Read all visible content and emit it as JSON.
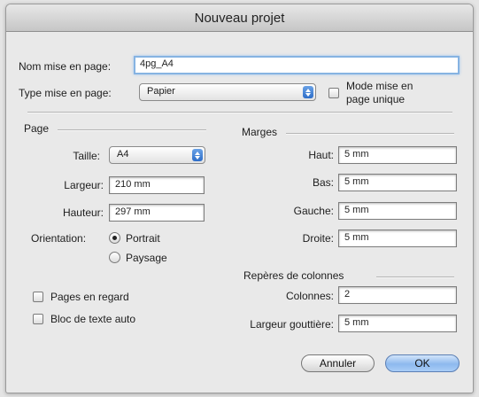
{
  "window": {
    "title": "Nouveau projet"
  },
  "top": {
    "layout_name_label": "Nom mise en page:",
    "layout_name_value": "4pg_A4",
    "layout_type_label": "Type mise en page:",
    "layout_type_value": "Papier",
    "single_page_label_line1": "Mode mise en",
    "single_page_label_line2": "page unique"
  },
  "page": {
    "section_label": "Page",
    "size_label": "Taille:",
    "size_value": "A4",
    "width_label": "Largeur:",
    "width_value": "210 mm",
    "height_label": "Hauteur:",
    "height_value": "297 mm",
    "orientation_label": "Orientation:",
    "portrait_label": "Portrait",
    "landscape_label": "Paysage",
    "facing_pages_label": "Pages en regard",
    "auto_text_box_label": "Bloc de texte auto"
  },
  "margins": {
    "section_label": "Marges",
    "top_label": "Haut:",
    "top_value": "5 mm",
    "bottom_label": "Bas:",
    "bottom_value": "5 mm",
    "left_label": "Gauche:",
    "left_value": "5 mm",
    "right_label": "Droite:",
    "right_value": "5 mm"
  },
  "column_guides": {
    "section_label": "Repères de colonnes",
    "columns_label": "Colonnes:",
    "columns_value": "2",
    "gutter_label": "Largeur gouttière:",
    "gutter_value": "5 mm"
  },
  "buttons": {
    "cancel": "Annuler",
    "ok": "OK"
  }
}
